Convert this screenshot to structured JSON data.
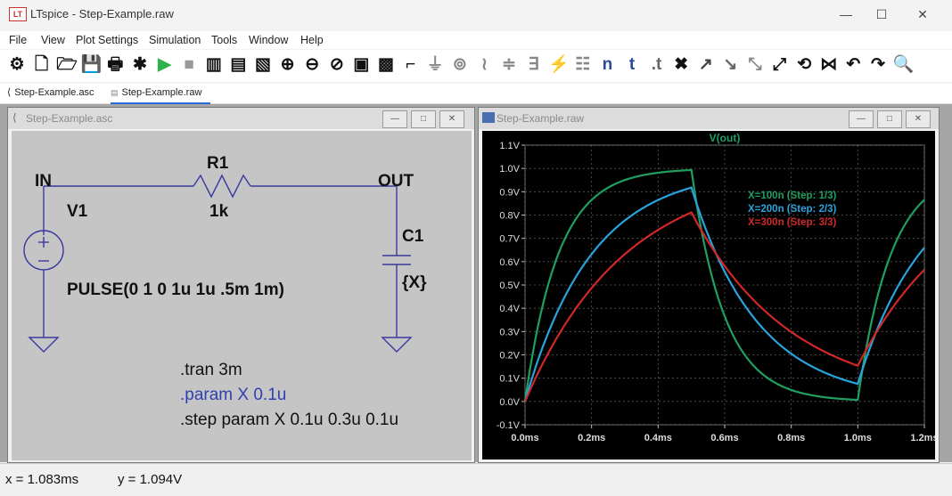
{
  "window": {
    "title": "LTspice - Step-Example.raw",
    "logo_text": "LT"
  },
  "menu": [
    "File",
    "View",
    "Plot Settings",
    "Simulation",
    "Tools",
    "Window",
    "Help"
  ],
  "toolbar_icons": [
    "settings-icon",
    "new-schematic-icon",
    "open-icon",
    "save-icon",
    "print-icon",
    "control-panel-icon",
    "run-icon",
    "halt-icon",
    "tile-vertical-icon",
    "tile-horizontal-icon",
    "cascade-icon",
    "zoom-in-icon",
    "zoom-out-icon",
    "zoom-fit-icon",
    "autorange-icon",
    "waveform-icon",
    "wire-icon",
    "ground-icon",
    "label-icon",
    "resistor-icon",
    "capacitor-icon",
    "inductor-icon",
    "diode-icon",
    "component-icon",
    "netlist-icon",
    "text-icon",
    "spice-directive-icon",
    "delete-icon",
    "duplicate-icon",
    "move-icon",
    "drag-icon",
    "undo-icon",
    "rotate-icon",
    "mirror-icon",
    "redo-back-icon",
    "redo-icon",
    "find-icon"
  ],
  "tabs": [
    {
      "label": "Step-Example.asc",
      "icon": "schematic-tab-icon"
    },
    {
      "label": "Step-Example.raw",
      "icon": "waveform-tab-icon"
    }
  ],
  "schematic": {
    "title": "Step-Example.asc",
    "in_label": "IN",
    "out_label": "OUT",
    "r1_name": "R1",
    "r1_value": "1k",
    "c1_name": "C1",
    "c1_value": "{X}",
    "v1_name": "V1",
    "v1_value": "PULSE(0 1 0 1u 1u .5m 1m)",
    "directive_tran": ".tran 3m",
    "directive_param": ".param X 0.1u",
    "directive_step": ".step param X 0.1u 0.3u 0.1u",
    "param_color": "#3040b0"
  },
  "plot": {
    "title": "Step-Example.raw",
    "trace_title": "V(out)",
    "y_ticks": [
      "1.1V",
      "1.0V",
      "0.9V",
      "0.8V",
      "0.7V",
      "0.6V",
      "0.5V",
      "0.4V",
      "0.3V",
      "0.2V",
      "0.1V",
      "0.0V",
      "-0.1V"
    ],
    "x_ticks": [
      "0.0ms",
      "0.2ms",
      "0.4ms",
      "0.6ms",
      "0.8ms",
      "1.0ms",
      "1.2ms"
    ],
    "legend": [
      {
        "label": "X=100n  (Step: 1/3)",
        "color": "#1fa060"
      },
      {
        "label": "X=200n  (Step: 2/3)",
        "color": "#29a3dc"
      },
      {
        "label": "X=300n  (Step: 3/3)",
        "color": "#d02828"
      }
    ]
  },
  "chart_data": {
    "type": "line",
    "title": "V(out)",
    "xlabel": "",
    "ylabel": "",
    "xlim": [
      0,
      1.2
    ],
    "ylim": [
      -0.1,
      1.1
    ],
    "x_unit": "ms",
    "y_unit": "V",
    "grid": true,
    "legend_position": "top-right",
    "series": [
      {
        "name": "X=100n  (Step: 1/3)",
        "color": "#1fa060",
        "tau_ms": 0.1,
        "x": [
          0,
          0.05,
          0.1,
          0.15,
          0.2,
          0.3,
          0.4,
          0.5,
          0.55,
          0.6,
          0.65,
          0.7,
          0.8,
          0.9,
          1.0,
          1.05,
          1.1,
          1.15,
          1.2
        ],
        "y": [
          0,
          0.39,
          0.63,
          0.78,
          0.86,
          0.95,
          0.98,
          0.99,
          0.6,
          0.36,
          0.22,
          0.13,
          0.05,
          0.02,
          0.01,
          0.4,
          0.64,
          0.78,
          0.87
        ]
      },
      {
        "name": "X=200n  (Step: 2/3)",
        "color": "#29a3dc",
        "tau_ms": 0.2,
        "x": [
          0,
          0.05,
          0.1,
          0.15,
          0.2,
          0.3,
          0.4,
          0.5,
          0.55,
          0.6,
          0.65,
          0.7,
          0.8,
          0.9,
          1.0,
          1.05,
          1.1,
          1.15,
          1.2
        ],
        "y": [
          0,
          0.22,
          0.39,
          0.53,
          0.63,
          0.78,
          0.86,
          0.92,
          0.71,
          0.56,
          0.43,
          0.34,
          0.2,
          0.12,
          0.07,
          0.27,
          0.43,
          0.56,
          0.65
        ]
      },
      {
        "name": "X=300n  (Step: 3/3)",
        "color": "#d02828",
        "tau_ms": 0.3,
        "x": [
          0,
          0.05,
          0.1,
          0.15,
          0.2,
          0.3,
          0.4,
          0.5,
          0.55,
          0.6,
          0.65,
          0.7,
          0.8,
          0.9,
          1.0,
          1.05,
          1.1,
          1.15,
          1.2
        ],
        "y": [
          0,
          0.15,
          0.28,
          0.39,
          0.49,
          0.63,
          0.74,
          0.81,
          0.69,
          0.58,
          0.49,
          0.42,
          0.3,
          0.22,
          0.16,
          0.29,
          0.4,
          0.49,
          0.57
        ]
      }
    ]
  },
  "status": {
    "x_readout": "x = 1.083ms",
    "y_readout": "y = 1.094V"
  }
}
